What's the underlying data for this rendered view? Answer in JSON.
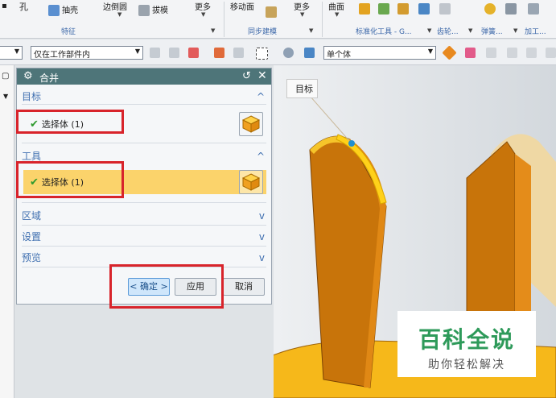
{
  "ribbon": {
    "kong": "孔",
    "chouke": "抽壳",
    "bian_dao_yuan": "边倒圆",
    "bamo": "拔模",
    "geng_duo_1": "更多",
    "yidong_mian": "移动面",
    "geng_duo_2": "更多",
    "qumian": "曲面",
    "group_feature": "特征",
    "group_sync": "同步建模",
    "group_std": "标准化工具 - G...",
    "group_gear": "齿轮...",
    "group_spring": "弹簧...",
    "group_machining": "加工..."
  },
  "selbar": {
    "filter_value": "仅在工作部件内",
    "scope_value": "单个体"
  },
  "dialog": {
    "title": "合并",
    "section_target": "目标",
    "target_select": "选择体 (1)",
    "section_tool": "工具",
    "tool_select": "选择体 (1)",
    "section_region": "区域",
    "section_settings": "设置",
    "section_preview": "预览",
    "ok_label": "< 确定 >",
    "apply_label": "应用",
    "cancel_label": "取消"
  },
  "viewport": {
    "target_label": "目标"
  },
  "watermark": {
    "title": "百科全说",
    "subtitle": "助你轻松解决"
  },
  "colors": {
    "accent_green": "#2e9a2e",
    "title_bar": "#4e7579",
    "highlight_row": "#fbd36b",
    "red_annotation": "#d8242b",
    "model_orange": "#c8740a",
    "model_yellow": "#f6b81a"
  }
}
